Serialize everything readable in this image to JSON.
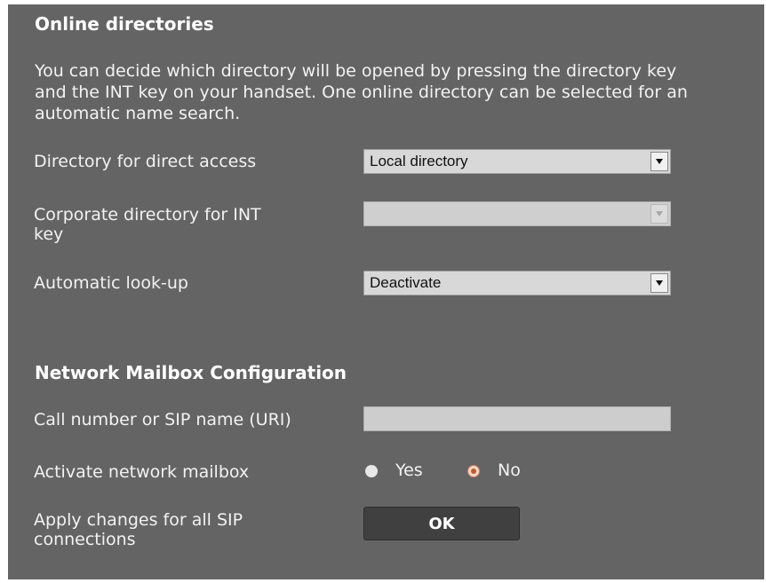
{
  "online_directories": {
    "heading": "Online directories",
    "intro": "You can decide which directory will be opened by pressing the directory key and the INT key on your handset. One online directory can be selected for an automatic name search.",
    "direct_access": {
      "label": "Directory for direct access",
      "value": "Local directory"
    },
    "corporate_int": {
      "label_line1": "Corporate directory for INT",
      "label_line2": "key",
      "value": ""
    },
    "auto_lookup": {
      "label": "Automatic look-up",
      "value": "Deactivate"
    }
  },
  "network_mailbox": {
    "heading": "Network Mailbox Configuration",
    "call_number": {
      "label": "Call number or SIP name (URI)",
      "value": ""
    },
    "activate": {
      "label": "Activate network mailbox",
      "yes_label": "Yes",
      "no_label": "No",
      "selected": "No"
    },
    "apply": {
      "label_line1": "Apply changes for all SIP",
      "label_line2": "connections",
      "button_label": "OK"
    }
  }
}
